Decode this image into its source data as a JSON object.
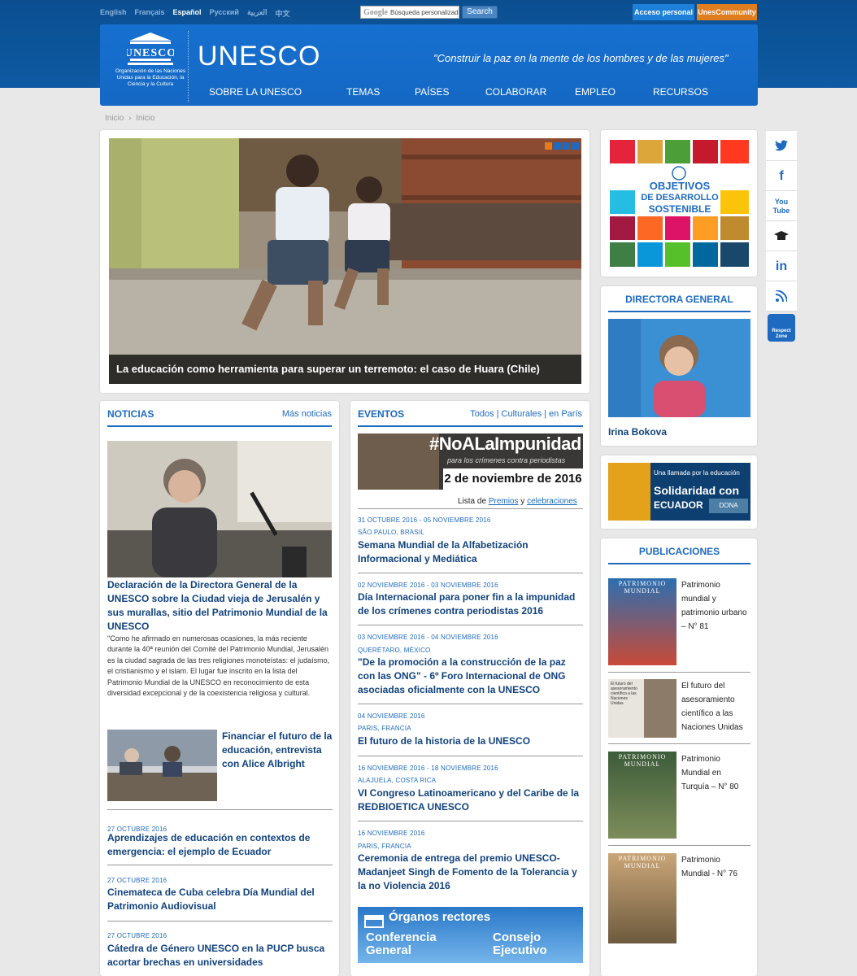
{
  "top": {
    "languages": [
      "English",
      "Français",
      "Español",
      "Русский",
      "العربية",
      "中文"
    ],
    "active_language": "Español",
    "search_placeholder": "Búsqueda personalizada",
    "search_brand": "Google",
    "search_button": "Search",
    "acceso": "Acceso personal",
    "unescommunity": "UnesCommunity"
  },
  "header": {
    "logo_word": "UNESCO",
    "logo_sub": "Organización de las Naciones Unidas para la Educación, la Ciencia y la Cultura",
    "brand": "UNESCO",
    "motto": "\"Construir la paz en la mente de los hombres y de las mujeres\"",
    "nav": [
      "SOBRE LA UNESCO",
      "TEMAS",
      "PAÍSES",
      "COLABORAR",
      "EMPLEO",
      "RECURSOS"
    ]
  },
  "breadcrumb": {
    "first": "Inicio",
    "sep": "›",
    "second": "Inicio"
  },
  "hero": {
    "caption": "La educación como herramienta para superar un terremoto: el caso de Huara (Chile)"
  },
  "noticias": {
    "title": "NOTICIAS",
    "more": "Más noticias",
    "lead": {
      "headline": "Declaración de la Directora General de la UNESCO sobre la Ciudad vieja de Jerusalén y sus murallas, sitio del Patrimonio Mundial de la UNESCO",
      "text": "\"Como he afirmado en numerosas ocasiones, la más reciente durante la 40ª reunión del Comité del Patrimonio Mundial, Jerusalén es la ciudad sagrada de las tres religiones monoteístas: el judaísmo, el cristianismo y el islam. El lugar fue inscrito en la lista del Patrimonio Mundial de la UNESCO en reconocimiento de esta diversidad excepcional y de la coexistencia religiosa y cultural."
    },
    "second": "Financiar el futuro de la educación, entrevista con Alice Albright",
    "items": [
      {
        "date": "27 OCTUBRE 2016",
        "headline": "Aprendizajes de educación en contextos de emergencia: el ejemplo de Ecuador"
      },
      {
        "date": "27 OCTUBRE 2016",
        "headline": "Cinemateca de Cuba celebra Día Mundial del Patrimonio Audiovisual"
      },
      {
        "date": "27 OCTUBRE 2016",
        "headline": "Cátedra de Género UNESCO en la PUCP busca acortar brechas en universidades"
      }
    ]
  },
  "eventos": {
    "title": "EVENTOS",
    "filters": "Todos | Culturales | en París",
    "banner_tag": "#NoALaImpunidad",
    "banner_sub": "para los crímenes contra periodistas",
    "banner_date": "2 de noviembre de 2016",
    "list_prefix": "Lista de",
    "list_premios": "Premios",
    "list_y": "y",
    "list_celebraciones": "celebraciones",
    "items": [
      {
        "date": "31 OCTUBRE 2016 - 05 NOVIEMBRE 2016",
        "loc": "SÃO PAULO, BRASIL",
        "headline": "Semana Mundial de la Alfabetización Informacional y Mediática"
      },
      {
        "date": "02 NOVIEMBRE 2016 - 03 NOVIEMBRE 2016",
        "loc": "",
        "headline": "Día Internacional para poner fin a la impunidad de los crímenes contra periodistas 2016"
      },
      {
        "date": "03 NOVIEMBRE 2016 - 04 NOVIEMBRE 2016",
        "loc": "QUERÉTARO, MÉXICO",
        "headline": "\"De la promoción a la construcción de la paz con las ONG\" - 6º Foro Internacional de ONG asociadas oficialmente con la UNESCO"
      },
      {
        "date": "04 NOVIEMBRE 2016",
        "loc": "PARIS, FRANCIA",
        "headline": "El futuro de la historia de la UNESCO"
      },
      {
        "date": "16 NOVIEMBRE 2016 - 18 NOVIEMBRE 2016",
        "loc": "ALAJUELA, COSTA RICA",
        "headline": "VI Congreso Latinoamericano y del Caribe de la REDBIOETICA UNESCO"
      },
      {
        "date": "16 NOVIEMBRE 2016",
        "loc": "PARIS, FRANCIA",
        "headline": "Ceremonia de entrega del premio UNESCO-Madanjeet Singh de Fomento de la Tolerancia y la no Violencia 2016"
      }
    ],
    "organos_title": "Órganos rectores",
    "organos_left": "Conferencia General",
    "organos_right": "Consejo Ejecutivo"
  },
  "ods": {
    "line1": "OBJETIVOS",
    "line2": "DE DESARROLLO",
    "line3": "SOSTENIBLE"
  },
  "directora": {
    "title": "DIRECTORA GENERAL",
    "name": "Irina Bokova"
  },
  "solidaridad": {
    "top": "Una llamada por la educación",
    "main1": "Solidaridad con",
    "main2": "ECUADOR",
    "dona": "DONA"
  },
  "publicaciones": {
    "title": "PUBLICACIONES",
    "items": [
      {
        "title": "Patrimonio mundial y patrimonio urbano – N° 81",
        "cover": "PATRIMONIO MUNDIAL"
      },
      {
        "title": "El futuro del asesoramiento científico a las Naciones Unidas",
        "cover": "El futuro del asesoramiento científico a las Naciones Unidas"
      },
      {
        "title": "Patrimonio Mundial en Turquía – N° 80",
        "cover": "PATRIMONIO MUNDIAL"
      },
      {
        "title": "Patrimonio Mundial - N° 76",
        "cover": "PATRIMONIO MUNDIAL"
      }
    ]
  },
  "social": [
    "twitter",
    "f",
    "You Tube",
    "mortarboard",
    "in",
    "rss",
    "Respect Zone"
  ]
}
